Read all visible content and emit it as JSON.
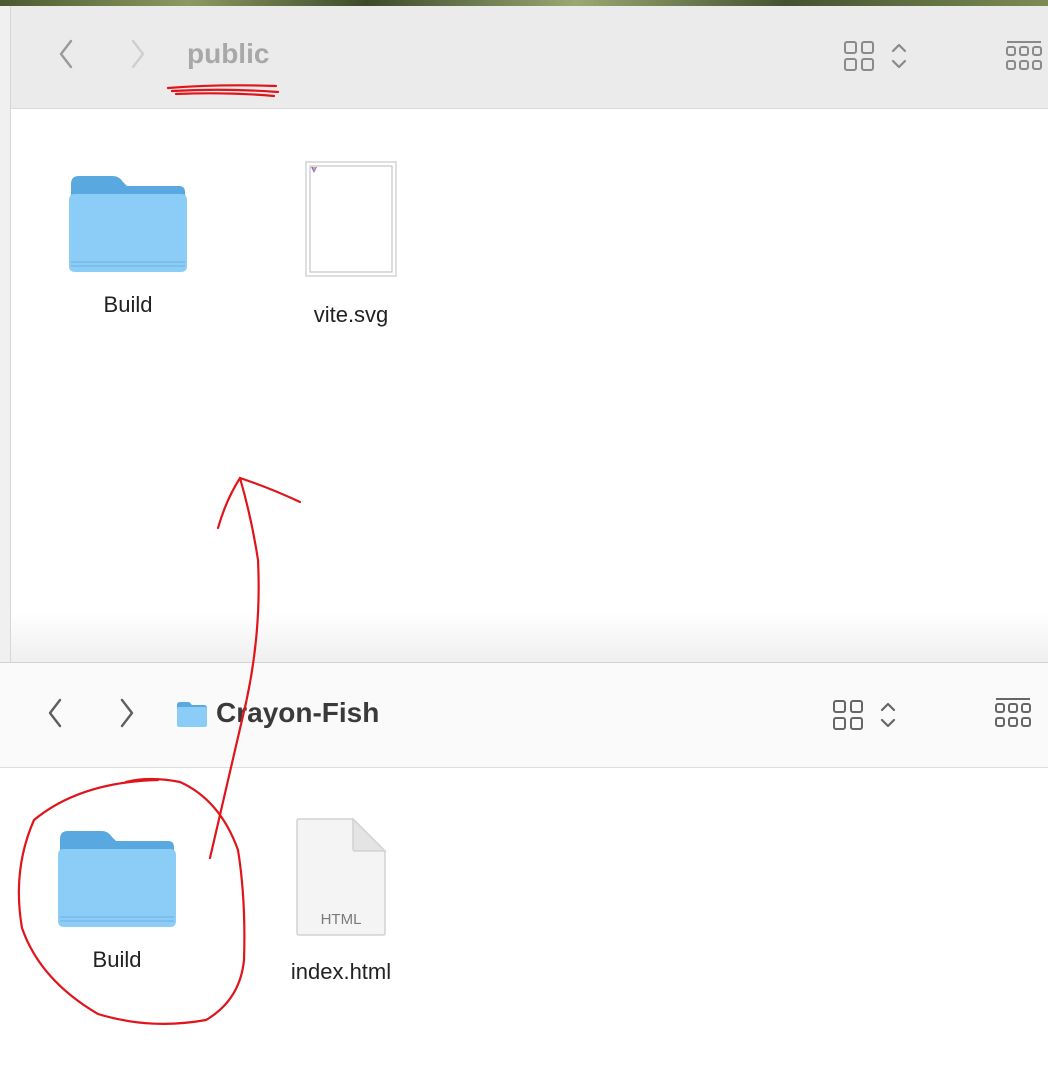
{
  "window_top": {
    "title": "public",
    "items": [
      {
        "label": "Build",
        "icon": "folder-icon"
      },
      {
        "label": "vite.svg",
        "icon": "svg-file-icon"
      }
    ]
  },
  "window_bottom": {
    "title": "Crayon-Fish",
    "title_icon": "folder-icon",
    "items": [
      {
        "label": "Build",
        "icon": "folder-icon"
      },
      {
        "label": "index.html",
        "icon": "html-file-icon",
        "badge": "HTML"
      }
    ]
  },
  "colors": {
    "folder_front": "#8ccdf7",
    "folder_back": "#5aa8e0",
    "annotation": "#e0141b",
    "toolbar_top": "#ebebeb",
    "toolbar_bottom": "#fafafa"
  }
}
